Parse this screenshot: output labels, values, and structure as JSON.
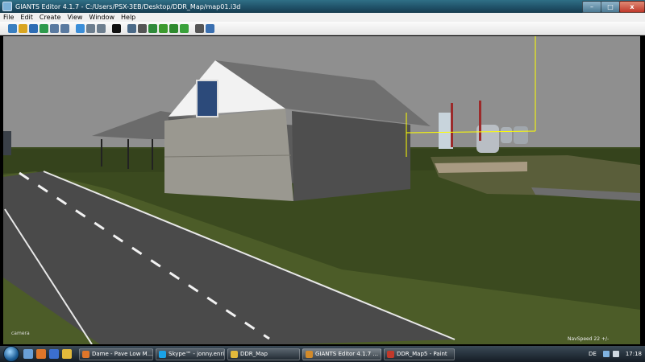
{
  "window": {
    "title": "GIANTS Editor 4.1.7 - C:/Users/PSX-3EB/Desktop/DDR_Map/map01.i3d",
    "minimize_label": "–",
    "maximize_label": "□",
    "close_label": "x"
  },
  "menu": [
    "File",
    "Edit",
    "Create",
    "View",
    "Window",
    "Help"
  ],
  "toolbar": {
    "icons": [
      {
        "name": "new-file-icon",
        "color": "#3a7fc0"
      },
      {
        "name": "open-folder-icon",
        "color": "#d9a520"
      },
      {
        "name": "save-icon",
        "color": "#2e6db4"
      },
      {
        "name": "save-as-icon",
        "color": "#2e9a4c"
      },
      {
        "name": "export-icon",
        "color": "#5a7aa0"
      },
      {
        "name": "import-icon",
        "color": "#5a7aa0"
      },
      {
        "name": "refresh-icon",
        "color": "#3b8ed8"
      },
      {
        "name": "undo-icon",
        "color": "#6d7e8e"
      },
      {
        "name": "redo-icon",
        "color": "#6d7e8e"
      },
      {
        "name": "play-icon",
        "color": "#111111"
      },
      {
        "name": "select-mode-icon",
        "color": "#4b6a88"
      },
      {
        "name": "move-mode-icon",
        "color": "#555555"
      },
      {
        "name": "terrain-sculpt-icon",
        "color": "#2f8a3a"
      },
      {
        "name": "terrain-paint-icon",
        "color": "#3c9a2e"
      },
      {
        "name": "foliage-paint-icon",
        "color": "#2e8a2e"
      },
      {
        "name": "grass-icon",
        "color": "#39a13a"
      },
      {
        "name": "settings-gear-icon",
        "color": "#555555"
      },
      {
        "name": "gear-search-icon",
        "color": "#3a6fb0"
      }
    ]
  },
  "viewport": {
    "camera_label": "camera",
    "navspeed_label": "NavSpeed 22 +/-"
  },
  "taskbar": {
    "quick_launch": [
      {
        "name": "show-desktop-icon",
        "color": "#6aa0d8"
      },
      {
        "name": "firefox-icon",
        "color": "#e0762a"
      },
      {
        "name": "media-player-icon",
        "color": "#3b6fd0"
      },
      {
        "name": "explorer-icon",
        "color": "#e2b93b"
      }
    ],
    "tasks": [
      {
        "label": "Dame - Pave Low M...",
        "icon": "firefox-icon",
        "color": "#e0762a",
        "active": false
      },
      {
        "label": "Skype™ - jonny.enri...",
        "icon": "skype-icon",
        "color": "#1aa3e8",
        "active": false
      },
      {
        "label": "DDR_Map",
        "icon": "folder-icon",
        "color": "#e2b93b",
        "active": false
      },
      {
        "label": "GIANTS Editor 4.1.7 ...",
        "icon": "giants-editor-icon",
        "color": "#d28a2a",
        "active": true
      },
      {
        "label": "DDR_Map5 - Paint",
        "icon": "paint-icon",
        "color": "#c0392b",
        "active": false
      }
    ],
    "language": "DE",
    "clock": "17:18"
  }
}
